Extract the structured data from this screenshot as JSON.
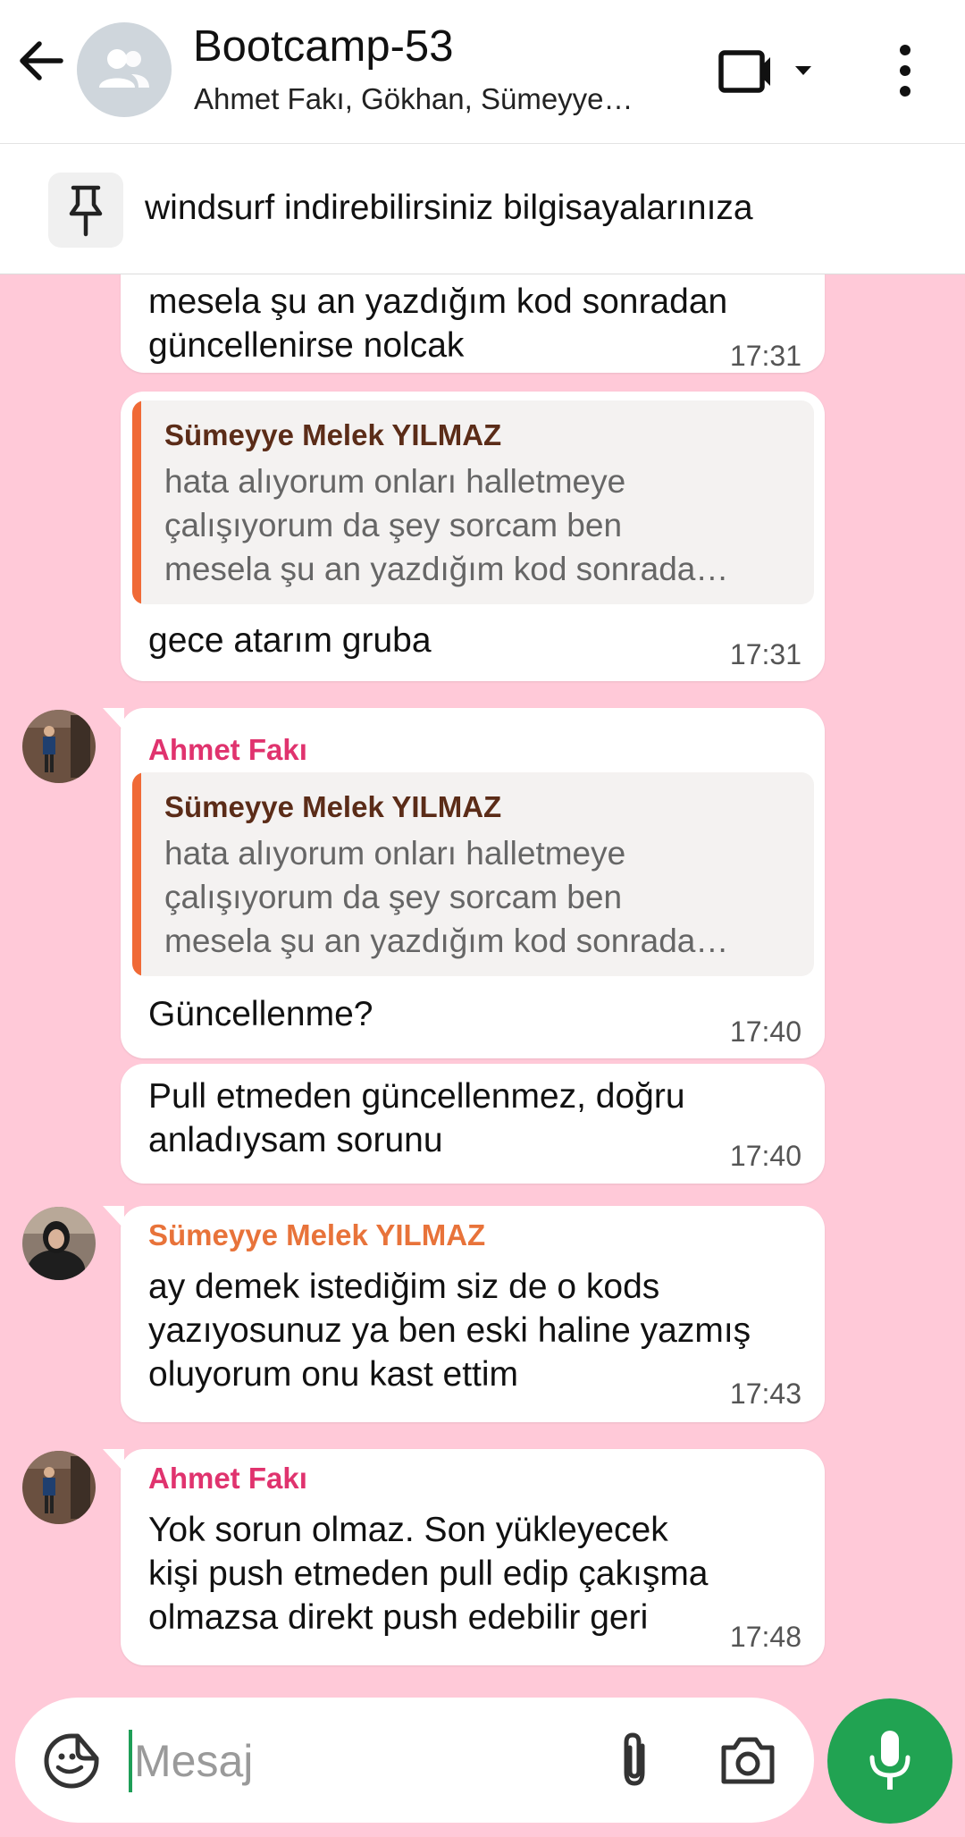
{
  "header": {
    "title": "Bootcamp-53",
    "subtitle": "Ahmet Fakı, Gökhan, Sümeyye…"
  },
  "pinned": {
    "text": "windsurf indirebilirsiniz bilgisayalarınıza"
  },
  "colors": {
    "accent": "#21a352",
    "chat_background": "#ffc9d8",
    "ahmet_name": "#e0336e",
    "sumeyye_name": "#e8733a",
    "quote_bar": "#f06a36"
  },
  "messages": [
    {
      "id": "m1",
      "text_lines": [
        "mesela şu an yazdığım kod sonradan",
        "güncellenirse nolcak"
      ],
      "time": "17:31"
    },
    {
      "id": "m2",
      "quote": {
        "name": "Sümeyye Melek YILMAZ",
        "text": "hata alıyorum onları halletmeye\nçalışıyorum da şey sorcam ben\nmesela şu an yazdığım kod sonrada…"
      },
      "text": "gece atarım gruba",
      "time": "17:31"
    },
    {
      "id": "m3",
      "sender": "Ahmet Fakı",
      "quote": {
        "name": "Sümeyye Melek YILMAZ",
        "text": "hata alıyorum onları halletmeye\nçalışıyorum da şey sorcam ben\nmesela şu an yazdığım kod sonrada…"
      },
      "text": "Güncellenme?",
      "time": "17:40"
    },
    {
      "id": "m4",
      "text_lines": [
        "Pull etmeden güncellenmez, doğru",
        "anladıysam sorunu"
      ],
      "time": "17:40"
    },
    {
      "id": "m5",
      "sender": "Sümeyye Melek YILMAZ",
      "text_lines": [
        "ay demek istediğim siz de o kods",
        "yazıyosunuz ya ben eski haline yazmış",
        "oluyorum onu kast ettim"
      ],
      "time": "17:43"
    },
    {
      "id": "m6",
      "sender": "Ahmet Fakı",
      "text_lines": [
        "Yok sorun olmaz. Son yükleyecek",
        "kişi push etmeden pull edip çakışma",
        "olmazsa direkt push edebilir geri"
      ],
      "time": "17:48"
    }
  ],
  "composer": {
    "placeholder": "Mesaj"
  }
}
